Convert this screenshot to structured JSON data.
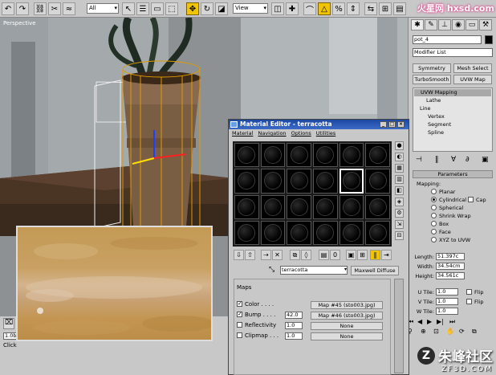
{
  "toolbar": {
    "selection_filter": "All",
    "coord_system": "View",
    "icons": [
      "undo-icon",
      "redo-icon",
      "link-icon",
      "unlink-icon",
      "bind-icon",
      "select-icon",
      "select-by-name-icon",
      "rect-select-icon",
      "crossing-icon",
      "move-icon",
      "rotate-icon",
      "scale-icon",
      "snap-icon",
      "angle-snap-icon",
      "percent-snap-icon",
      "spinner-snap-icon",
      "mirror-icon",
      "align-icon"
    ]
  },
  "viewport": {
    "label": "Perspective"
  },
  "command_panel": {
    "object_name": "pot_4",
    "modifier_list": "Modifier List",
    "buttons": [
      "Symmetry",
      "Mesh Select",
      "TurboSmooth",
      "UVW Map"
    ],
    "stack": [
      "UVW Mapping",
      "Lathe",
      "Line",
      "Vertex",
      "Segment",
      "Spline"
    ],
    "parameters_label": "Parameters",
    "mapping_label": "Mapping:",
    "mapping_options": [
      "Planar",
      "Cylindrical",
      "Spherical",
      "Shrink Wrap",
      "Box",
      "Face",
      "XYZ to UVW"
    ],
    "mapping_selected": "Cylindrical",
    "cap_label": "Cap",
    "length_label": "Length:",
    "length_value": "51.397c",
    "width_label": "Width:",
    "width_value": "34.54cm",
    "height_label": "Height:",
    "height_value": "34.561c",
    "utile_label": "U Tile:",
    "utile_value": "1.0",
    "vtile_label": "V Tile:",
    "vtile_value": "1.0",
    "wtile_label": "W Tile:",
    "wtile_value": "1.0",
    "flip_label": "Flip"
  },
  "material_editor": {
    "title": "Material Editor - terracotta",
    "menu": [
      "Material",
      "Navigation",
      "Options",
      "Utilities"
    ],
    "material_name": "terracotta",
    "material_type": "Maxwell Diffuse",
    "maps_label": "Maps",
    "maps": [
      {
        "label": "Color . . . .",
        "checked": true,
        "amount": "",
        "map": "Map #45 (sto003.jpg)"
      },
      {
        "label": "Bump . . . .",
        "checked": true,
        "amount": "42.0",
        "map": "Map #46 (sto003.jpg)"
      },
      {
        "label": "Reflectivity",
        "checked": false,
        "amount": "1.0",
        "map": "None"
      },
      {
        "label": "Clipmap . . .",
        "checked": false,
        "amount": "1.0",
        "map": "None"
      }
    ]
  },
  "status": {
    "click_text": "Click",
    "zoom_value": "1.0b"
  },
  "watermark": {
    "top_logo": "火星网 hxsd.com",
    "brand": "朱峰社区",
    "site": "ZF3D.COM"
  }
}
